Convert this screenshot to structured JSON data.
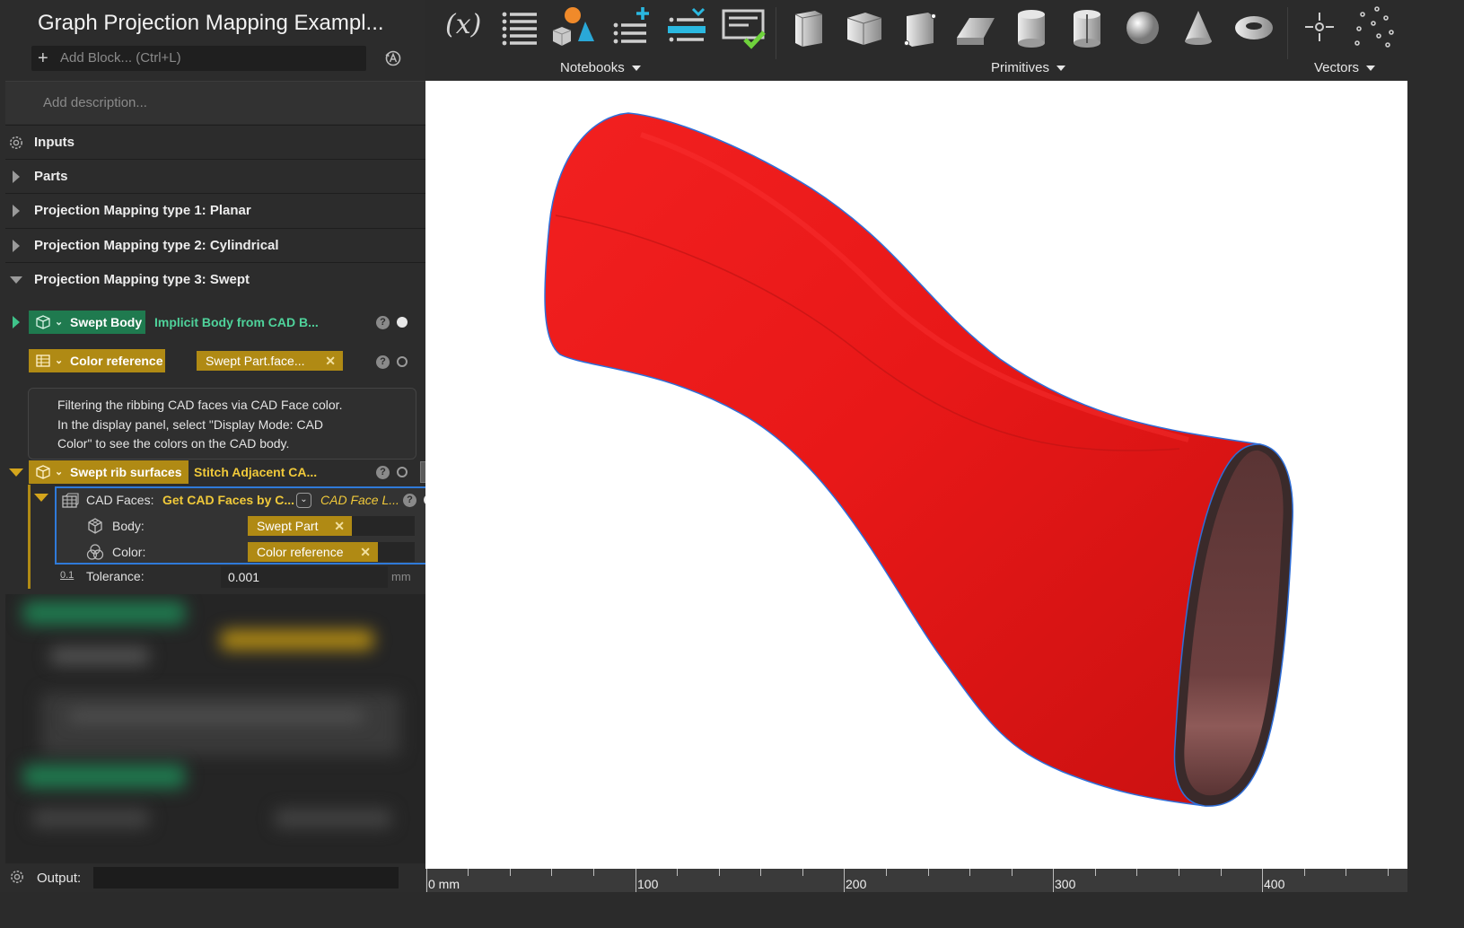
{
  "app": {
    "title": "Graph Projection Mapping Exampl...",
    "add_block_placeholder": "Add Block... (Ctrl+L)",
    "description_placeholder": "Add description..."
  },
  "sections": [
    {
      "label": "Inputs"
    },
    {
      "label": "Parts"
    },
    {
      "label": "Projection Mapping type 1: Planar"
    },
    {
      "label": "Projection Mapping type 2: Cylindrical"
    },
    {
      "label": "Projection Mapping type 3: Swept"
    }
  ],
  "blocks": {
    "swept_body": {
      "name": "Swept Body",
      "value": "Implicit Body from CAD B..."
    },
    "color_reference": {
      "name": "Color reference",
      "value": "Swept Part.face..."
    },
    "comment_lines": [
      "Filtering the ribbing CAD faces via CAD Face color.",
      "In the display panel, select \"Display Mode: CAD",
      "Color\" to see the colors on the CAD body."
    ],
    "swept_rib": {
      "name": "Swept rib surfaces",
      "value": "Stitch Adjacent CA..."
    },
    "cad_faces": {
      "label": "CAD Faces:",
      "function": "Get CAD Faces by C...",
      "hint": "CAD Face L...",
      "body_label": "Body:",
      "body_value": "Swept Part",
      "color_label": "Color:",
      "color_value": "Color reference"
    },
    "tolerance": {
      "icon_text": "0.1",
      "label": "Tolerance:",
      "value": "0.001",
      "unit": "mm"
    }
  },
  "help_glyph": "?",
  "remove_glyph": "✕",
  "output": {
    "label": "Output:"
  },
  "toolbar": {
    "variable_icon_text": "(x)",
    "groups": [
      "Notebooks",
      "Primitives",
      "Vectors"
    ]
  },
  "ruler": {
    "labels": [
      "0 mm",
      "100",
      "200",
      "300",
      "400"
    ]
  },
  "colors": {
    "body_red": "#ee1c1c",
    "outline_blue": "#2f7ad9",
    "block_green": "#1f7a4f",
    "block_gold": "#b08a14",
    "green_text": "#4fd39b",
    "yellow_text": "#f0c93a"
  }
}
